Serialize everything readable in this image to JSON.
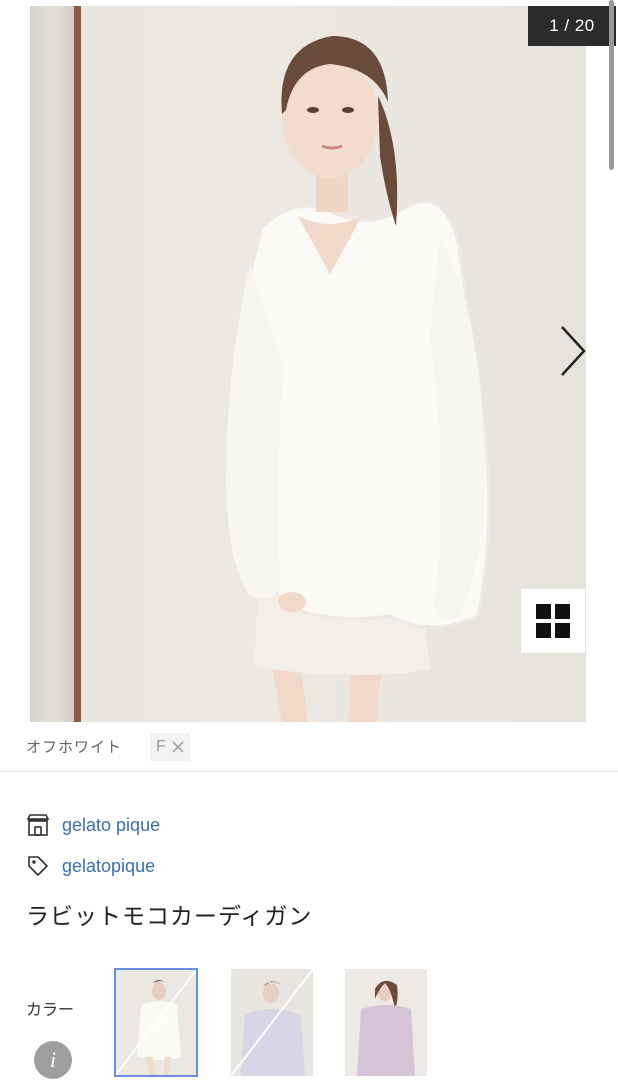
{
  "gallery": {
    "counter": "1 / 20",
    "next_icon": "chevron-right-icon",
    "grid_icon": "grid-view-icon"
  },
  "option": {
    "color_name": "オフホワイト",
    "size": "F",
    "size_remove_icon": "close-icon"
  },
  "product": {
    "brand": "gelato pique",
    "brand_icon": "shop-icon",
    "tag": "gelatopique",
    "tag_icon": "tag-icon",
    "title": "ラビットモコカーディガン"
  },
  "color_selector": {
    "label": "カラー",
    "info_glyph": "i",
    "swatches": [
      {
        "tone": "#f4f2ee",
        "selected": true,
        "sold_out": true
      },
      {
        "tone": "#d9d4e6",
        "selected": false,
        "sold_out": true
      },
      {
        "tone": "#d7c3d8",
        "selected": false,
        "sold_out": false
      }
    ]
  },
  "colors": {
    "link": "#3a6fb0",
    "counter_bg": "#2b2b2b",
    "selected_outline": "#6b8fe0"
  }
}
